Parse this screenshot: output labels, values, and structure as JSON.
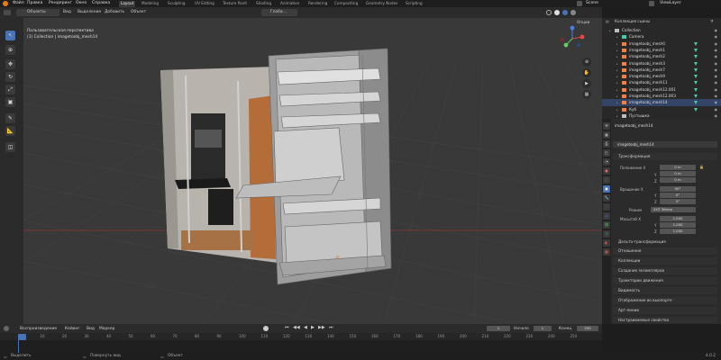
{
  "menu": {
    "items": [
      "Файл",
      "Правка",
      "Рендеринг",
      "Окно",
      "Справка"
    ]
  },
  "workspaces": [
    "Layout",
    "Modeling",
    "Sculpting",
    "UV Editing",
    "Texture Paint",
    "Shading",
    "Animation",
    "Rendering",
    "Compositing",
    "Geometry Nodes",
    "Scripting"
  ],
  "top_right": {
    "scene": "Scene",
    "view_layer": "ViewLayer"
  },
  "header": {
    "mode": "Объекты",
    "view": "Вид",
    "select": "Выделение",
    "add": "Добавить",
    "object": "Объект",
    "orientation": "Глоба..."
  },
  "viewport": {
    "title": "Пользовательская перспектива",
    "subtitle": "(1) Collection | imagetoobj_mesh14",
    "options": "Опции"
  },
  "outliner": {
    "header": "Коллекция сцены",
    "rows": [
      {
        "name": "Collection",
        "type": "collection"
      },
      {
        "name": "Camera",
        "type": "camera"
      },
      {
        "name": "imagetoobj_mesh0",
        "type": "mesh"
      },
      {
        "name": "imagetoobj_mesh1",
        "type": "mesh"
      },
      {
        "name": "imagetoobj_mesh2",
        "type": "mesh"
      },
      {
        "name": "imagetoobj_mesh3",
        "type": "mesh"
      },
      {
        "name": "imagetoobj_mesh7",
        "type": "mesh"
      },
      {
        "name": "imagetoobj_mesh9",
        "type": "mesh"
      },
      {
        "name": "imagetoobj_mesh11",
        "type": "mesh"
      },
      {
        "name": "imagetoobj_mesh12.001",
        "type": "mesh"
      },
      {
        "name": "imagetoobj_mesh12.003",
        "type": "mesh"
      },
      {
        "name": "imagetoobj_mesh14",
        "type": "mesh"
      },
      {
        "name": "Куб",
        "type": "mesh"
      },
      {
        "name": "Пустышка",
        "type": "empty"
      }
    ]
  },
  "properties": {
    "object_header": "imagetoobj_mesh14",
    "object_name": "imagetoobj_mesh14",
    "transform_title": "Трансформация",
    "location_label": "Положение X",
    "rotation_label": "Вращение X",
    "mode_label": "Режим",
    "mode_value": "XYZ Эйлер",
    "scale_label": "Масштаб X",
    "axis_y": "Y",
    "axis_z": "Z",
    "loc": [
      "0 m",
      "0 m",
      "0 m"
    ],
    "rot": [
      "90°",
      "0°",
      "0°"
    ],
    "scale": [
      "1.000",
      "1.000",
      "1.000"
    ],
    "sections": [
      "Дельта-трансформация",
      "Отношения",
      "Коллекции",
      "Создание экземпляров",
      "Траектории движения",
      "Видимость",
      "Отображение во вьюпорте",
      "Арт-линии",
      "Настраиваемые свойства"
    ]
  },
  "timeline": {
    "playback": "Воспроизведение",
    "keying": "Кейинг",
    "view": "Вид",
    "marker": "Маркер",
    "current_frame": "1",
    "start_label": "Начало",
    "start": "1",
    "end_label": "Конец",
    "end": "250",
    "ticks": [
      "0",
      "10",
      "20",
      "30",
      "40",
      "50",
      "60",
      "70",
      "80",
      "90",
      "100",
      "110",
      "120",
      "130",
      "140",
      "150",
      "160",
      "170",
      "180",
      "190",
      "200",
      "210",
      "220",
      "230",
      "240",
      "250"
    ]
  },
  "status": {
    "left": "Выделить",
    "middle": "Повернуть вид",
    "right": "Объект",
    "version": "4.0.2"
  },
  "colors": {
    "accent": "#4772b3",
    "frame": "#4772b3",
    "mesh_icon": "#e5854b",
    "collection_icon": "#bdbdbd",
    "camera_icon": "#4dc9a4"
  }
}
